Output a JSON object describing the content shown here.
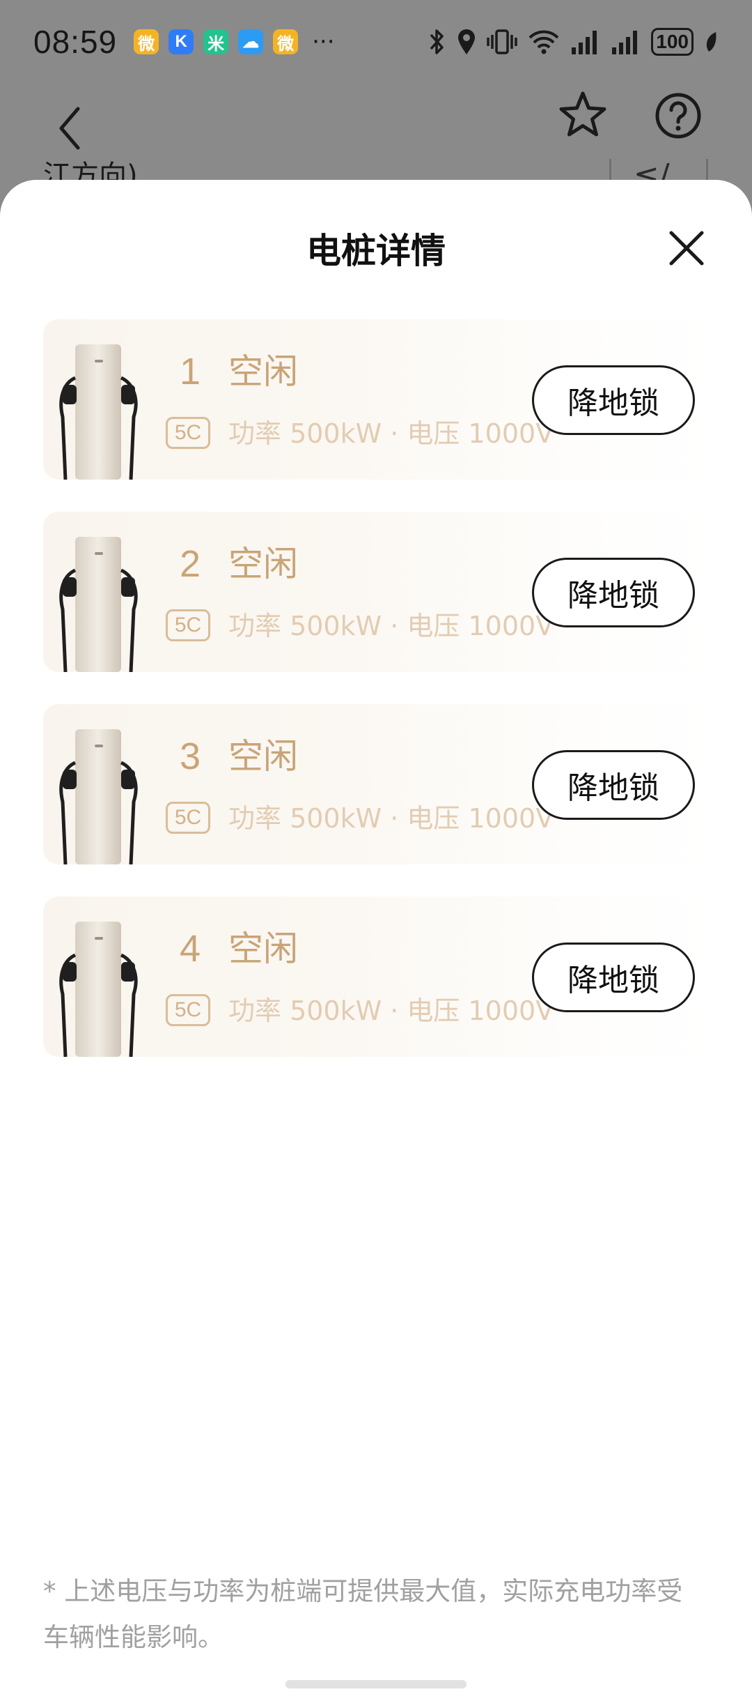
{
  "status_bar": {
    "time": "08:59",
    "notification_icons": [
      {
        "name": "weibo-icon",
        "color": "#f5b324",
        "glyph": "微"
      },
      {
        "name": "k-app-icon",
        "color": "#2f7cf6",
        "glyph": "K"
      },
      {
        "name": "mi-home-icon",
        "color": "#22c38e",
        "glyph": "米"
      },
      {
        "name": "cloud-icon",
        "color": "#2b9bf4",
        "glyph": "☁"
      },
      {
        "name": "weibo-icon-2",
        "color": "#f5b324",
        "glyph": "微"
      }
    ],
    "more": "···",
    "battery": "100"
  },
  "background_page": {
    "snippet": "江方向)",
    "glyph": "≤/"
  },
  "sheet": {
    "title": "电桩详情",
    "piles": [
      {
        "number": "1",
        "status": "空闲",
        "badge": "5C",
        "specs": "功率 500kW · 电压 1000V",
        "action": "降地锁"
      },
      {
        "number": "2",
        "status": "空闲",
        "badge": "5C",
        "specs": "功率 500kW · 电压 1000V",
        "action": "降地锁"
      },
      {
        "number": "3",
        "status": "空闲",
        "badge": "5C",
        "specs": "功率 500kW · 电压 1000V",
        "action": "降地锁"
      },
      {
        "number": "4",
        "status": "空闲",
        "badge": "5C",
        "specs": "功率 500kW · 电压 1000V",
        "action": "降地锁"
      }
    ],
    "footnote": "* 上述电压与功率为桩端可提供最大值，实际充电功率受车辆性能影响。"
  },
  "colors": {
    "accent_gold": "#c9a478",
    "spec_text": "#e2ccb2",
    "dim_overlay": "#8a8a8a"
  }
}
